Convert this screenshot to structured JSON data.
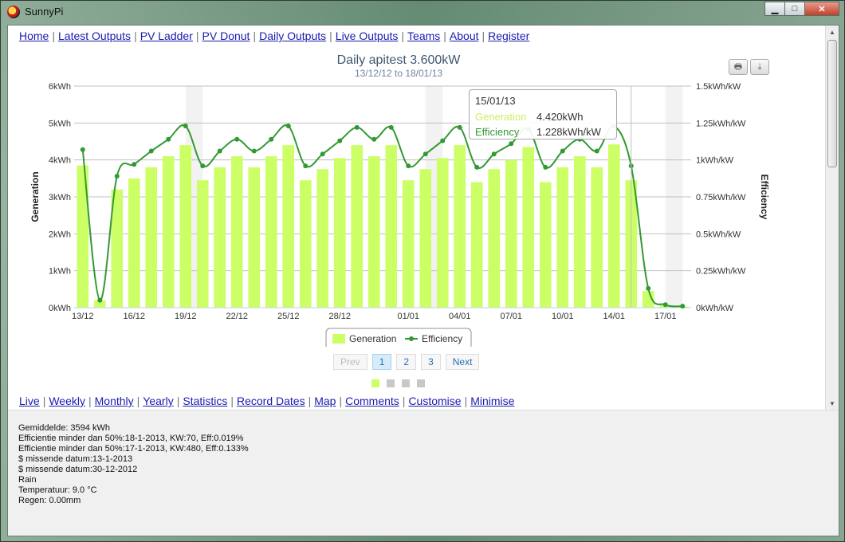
{
  "window": {
    "title": "SunnyPi",
    "minimize_icon": "minimize-icon",
    "maximize_icon": "maximize-icon",
    "close_icon": "close-icon"
  },
  "nav": {
    "items": [
      "Home",
      "Latest Outputs",
      "PV Ladder",
      "PV Donut",
      "Daily Outputs",
      "Live Outputs",
      "Teams",
      "About",
      "Register"
    ]
  },
  "subnav": {
    "items": [
      "Live",
      "Weekly",
      "Monthly",
      "Yearly",
      "Statistics",
      "Record Dates",
      "Map",
      "Comments",
      "Customise",
      "Minimise"
    ]
  },
  "chart_toolbar": {
    "print_icon": "print-icon",
    "export_icon": "download-icon"
  },
  "tooltip": {
    "date": "15/01/13",
    "gen_label": "Generation",
    "gen_value": "4.420kWh",
    "eff_label": "Efficiency",
    "eff_value": "1.228kWh/kW"
  },
  "pager": {
    "prev": "Prev",
    "pages": [
      "1",
      "2",
      "3"
    ],
    "active": "1",
    "next": "Next"
  },
  "info_lines": [
    "Gemiddelde: 3594 kWh",
    "Efficientie minder dan 50%:18-1-2013, KW:70, Eff:0.019%",
    "Efficientie minder dan 50%:17-1-2013, KW:480, Eff:0.133%",
    "$ missende datum:13-1-2013",
    "$ missende datum:30-12-2012",
    "Rain",
    "Temperatuur: 9.0 °C",
    "Regen: 0.00mm"
  ],
  "colors": {
    "bar": "#ccff66",
    "line": "#339933",
    "link": "#1a1ab0"
  },
  "chart_data": {
    "type": "bar",
    "title": "Daily apitest 3.600kW",
    "subtitle": "13/12/12 to 18/01/13",
    "ylabel": "Generation",
    "y2label": "Efficiency",
    "ylim": [
      0,
      6
    ],
    "y2lim": [
      0,
      1.5
    ],
    "yticks": [
      "0kWh",
      "1kWh",
      "2kWh",
      "3kWh",
      "4kWh",
      "5kWh",
      "6kWh"
    ],
    "y2ticks": [
      "0kWh/kW",
      "0.25kWh/kW",
      "0.5kWh/kW",
      "0.75kWh/kW",
      "1kWh/kW",
      "1.25kWh/kW",
      "1.5kWh/kW"
    ],
    "xticks": [
      "13/12",
      "16/12",
      "19/12",
      "22/12",
      "25/12",
      "28/12",
      "01/01",
      "04/01",
      "07/01",
      "10/01",
      "14/01",
      "17/01"
    ],
    "categories": [
      "13/12",
      "14/12",
      "15/12",
      "16/12",
      "17/12",
      "18/12",
      "19/12",
      "20/12",
      "21/12",
      "22/12",
      "23/12",
      "24/12",
      "25/12",
      "26/12",
      "27/12",
      "28/12",
      "29/12",
      "30/12",
      "31/12",
      "01/01",
      "02/01",
      "03/01",
      "04/01",
      "05/01",
      "06/01",
      "07/01",
      "08/01",
      "09/01",
      "10/01",
      "11/01",
      "12/01",
      "14/01",
      "15/01",
      "16/01",
      "17/01",
      "18/01"
    ],
    "legend": [
      "Generation",
      "Efficiency"
    ],
    "legend_position": "bottom",
    "grid": true,
    "series": [
      {
        "name": "Generation",
        "type": "bar",
        "axis": "left",
        "values": [
          3.85,
          0.2,
          3.2,
          3.5,
          3.8,
          4.1,
          4.4,
          3.45,
          3.8,
          4.1,
          3.8,
          4.1,
          4.4,
          3.45,
          3.75,
          4.05,
          4.4,
          4.1,
          4.4,
          3.45,
          3.75,
          4.05,
          4.4,
          3.4,
          3.75,
          4.0,
          4.35,
          3.4,
          3.8,
          4.1,
          3.8,
          4.42,
          3.45,
          0.45,
          0.07,
          0.03
        ]
      },
      {
        "name": "Efficiency",
        "type": "line",
        "axis": "right",
        "values": [
          1.07,
          0.05,
          0.89,
          0.97,
          1.06,
          1.14,
          1.23,
          0.96,
          1.06,
          1.14,
          1.06,
          1.14,
          1.23,
          0.96,
          1.04,
          1.13,
          1.22,
          1.14,
          1.22,
          0.96,
          1.04,
          1.13,
          1.22,
          0.95,
          1.04,
          1.11,
          1.21,
          0.95,
          1.06,
          1.14,
          1.06,
          1.228,
          0.96,
          0.13,
          0.02,
          0.01
        ]
      }
    ]
  }
}
